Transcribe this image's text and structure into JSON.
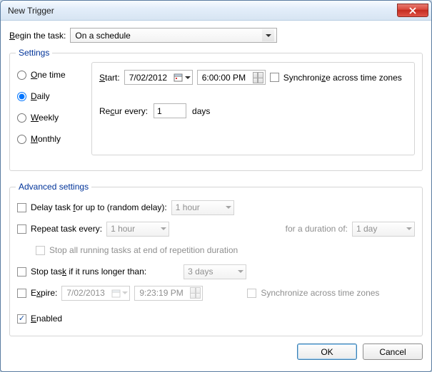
{
  "window": {
    "title": "New Trigger"
  },
  "begin": {
    "label": "Begin the task:",
    "value": "On a schedule"
  },
  "settings": {
    "legend": "Settings",
    "options": {
      "one_time": "One time",
      "daily": "Daily",
      "weekly": "Weekly",
      "monthly": "Monthly"
    },
    "selected": "daily",
    "start_label": "Start:",
    "start_date": "7/02/2012",
    "start_time": "6:00:00 PM",
    "sync_tz_label": "Synchronize across time zones",
    "sync_tz_checked": false,
    "recur_label_pre": "Recur every:",
    "recur_value": "1",
    "recur_label_post": "days"
  },
  "advanced": {
    "legend": "Advanced settings",
    "delay": {
      "checked": false,
      "label": "Delay task for up to (random delay):",
      "value": "1 hour"
    },
    "repeat": {
      "checked": false,
      "label": "Repeat task every:",
      "value": "1 hour",
      "duration_label": "for a duration of:",
      "duration_value": "1 day"
    },
    "stop_at_end": {
      "checked": false,
      "label": "Stop all running tasks at end of repetition duration"
    },
    "stop_longer": {
      "checked": false,
      "label": "Stop task if it runs longer than:",
      "value": "3 days"
    },
    "expire": {
      "checked": false,
      "label": "Expire:",
      "date": "7/02/2013",
      "time": "9:23:19 PM",
      "sync_label": "Synchronize across time zones",
      "sync_checked": false
    },
    "enabled": {
      "checked": true,
      "label": "Enabled"
    }
  },
  "buttons": {
    "ok": "OK",
    "cancel": "Cancel"
  }
}
